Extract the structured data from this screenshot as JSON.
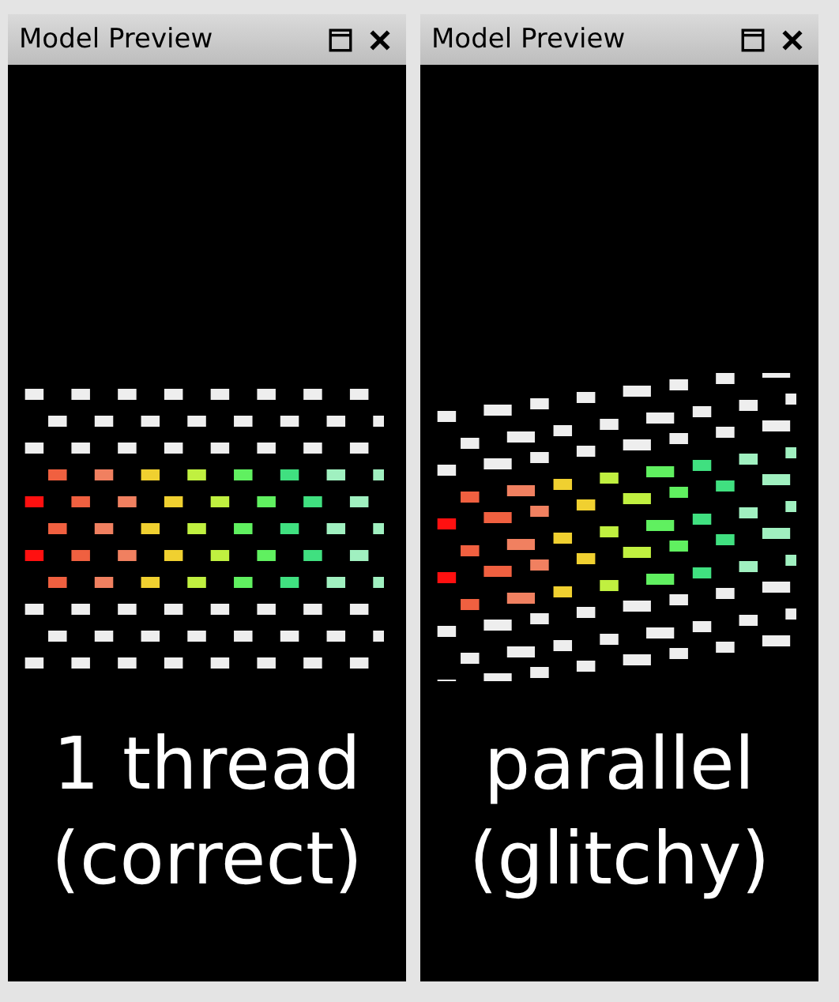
{
  "panels": [
    {
      "title": "Model Preview",
      "caption": [
        "1 thread",
        "(correct)"
      ]
    },
    {
      "title": "Model Preview",
      "caption": [
        "parallel",
        "(glitchy)"
      ]
    }
  ]
}
